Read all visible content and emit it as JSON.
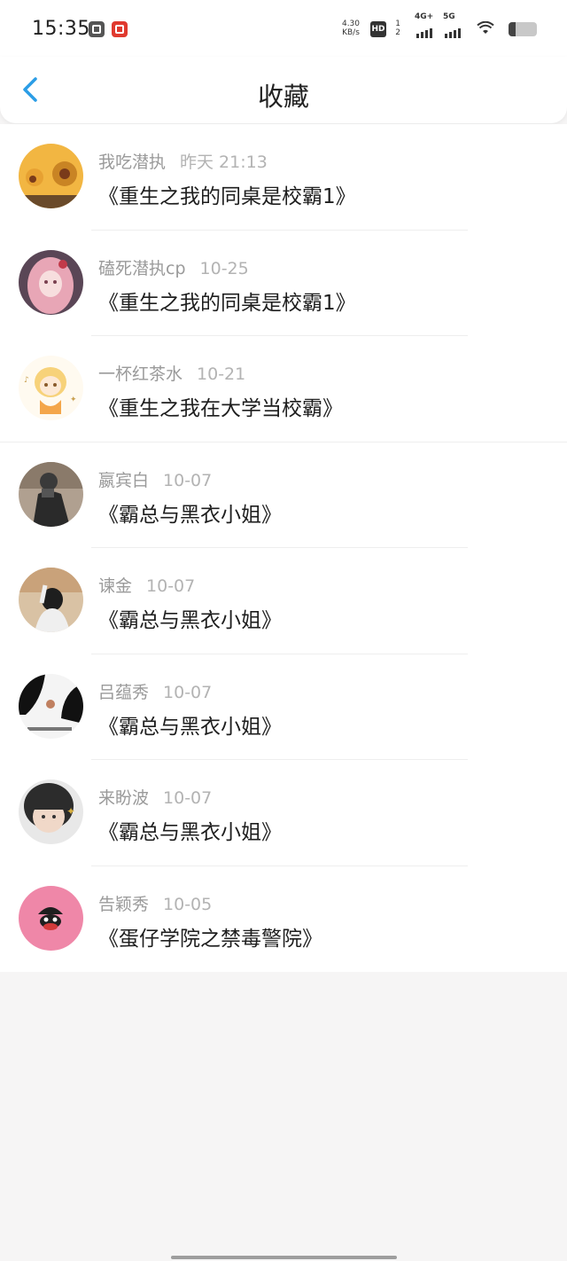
{
  "status_bar": {
    "time": "15:35",
    "network_speed_value": "4.30",
    "network_speed_unit": "KB/s",
    "hd_label": "HD",
    "hd_sim": "1\n2",
    "signal_1": "4G+",
    "signal_2": "5G",
    "battery_level": 0.25,
    "icons": [
      "gallery-app-icon",
      "red-app-icon",
      "hd-call-icon",
      "signal-4g-icon",
      "signal-5g-icon",
      "wifi-icon",
      "battery-icon"
    ]
  },
  "header": {
    "title": "收藏",
    "back_icon": "chevron-left-icon",
    "accent_color": "#2b9de6"
  },
  "favorites": [
    {
      "user": "我吃潜执",
      "date": "昨天 21:13",
      "title": "《重生之我的同桌是校霸1》",
      "avatar_colors": [
        "#f2b642",
        "#7a3b1a"
      ]
    },
    {
      "user": "磕死潜执cp",
      "date": "10-25",
      "title": "《重生之我的同桌是校霸1》",
      "avatar_colors": [
        "#e8a6b6",
        "#4a3a4a"
      ]
    },
    {
      "user": "一杯红茶水",
      "date": "10-21",
      "title": "《重生之我在大学当校霸》",
      "avatar_colors": [
        "#f7d27a",
        "#fffaf0"
      ]
    },
    {
      "user": "嬴宾白",
      "date": "10-07",
      "title": "《霸总与黑衣小姐》",
      "avatar_colors": [
        "#3a3a3a",
        "#b0a090"
      ]
    },
    {
      "user": "谏金",
      "date": "10-07",
      "title": "《霸总与黑衣小姐》",
      "avatar_colors": [
        "#c9a27a",
        "#2a2a2a"
      ]
    },
    {
      "user": "吕蕴秀",
      "date": "10-07",
      "title": "《霸总与黑衣小姐》",
      "avatar_colors": [
        "#111111",
        "#f4f4f4"
      ]
    },
    {
      "user": "来盼波",
      "date": "10-07",
      "title": "《霸总与黑衣小姐》",
      "avatar_colors": [
        "#2c2c2c",
        "#f0d8c8"
      ]
    },
    {
      "user": "告颖秀",
      "date": "10-05",
      "title": "《蛋仔学院之禁毒警院》",
      "avatar_colors": [
        "#ef87a8",
        "#1f1f1f"
      ]
    }
  ]
}
